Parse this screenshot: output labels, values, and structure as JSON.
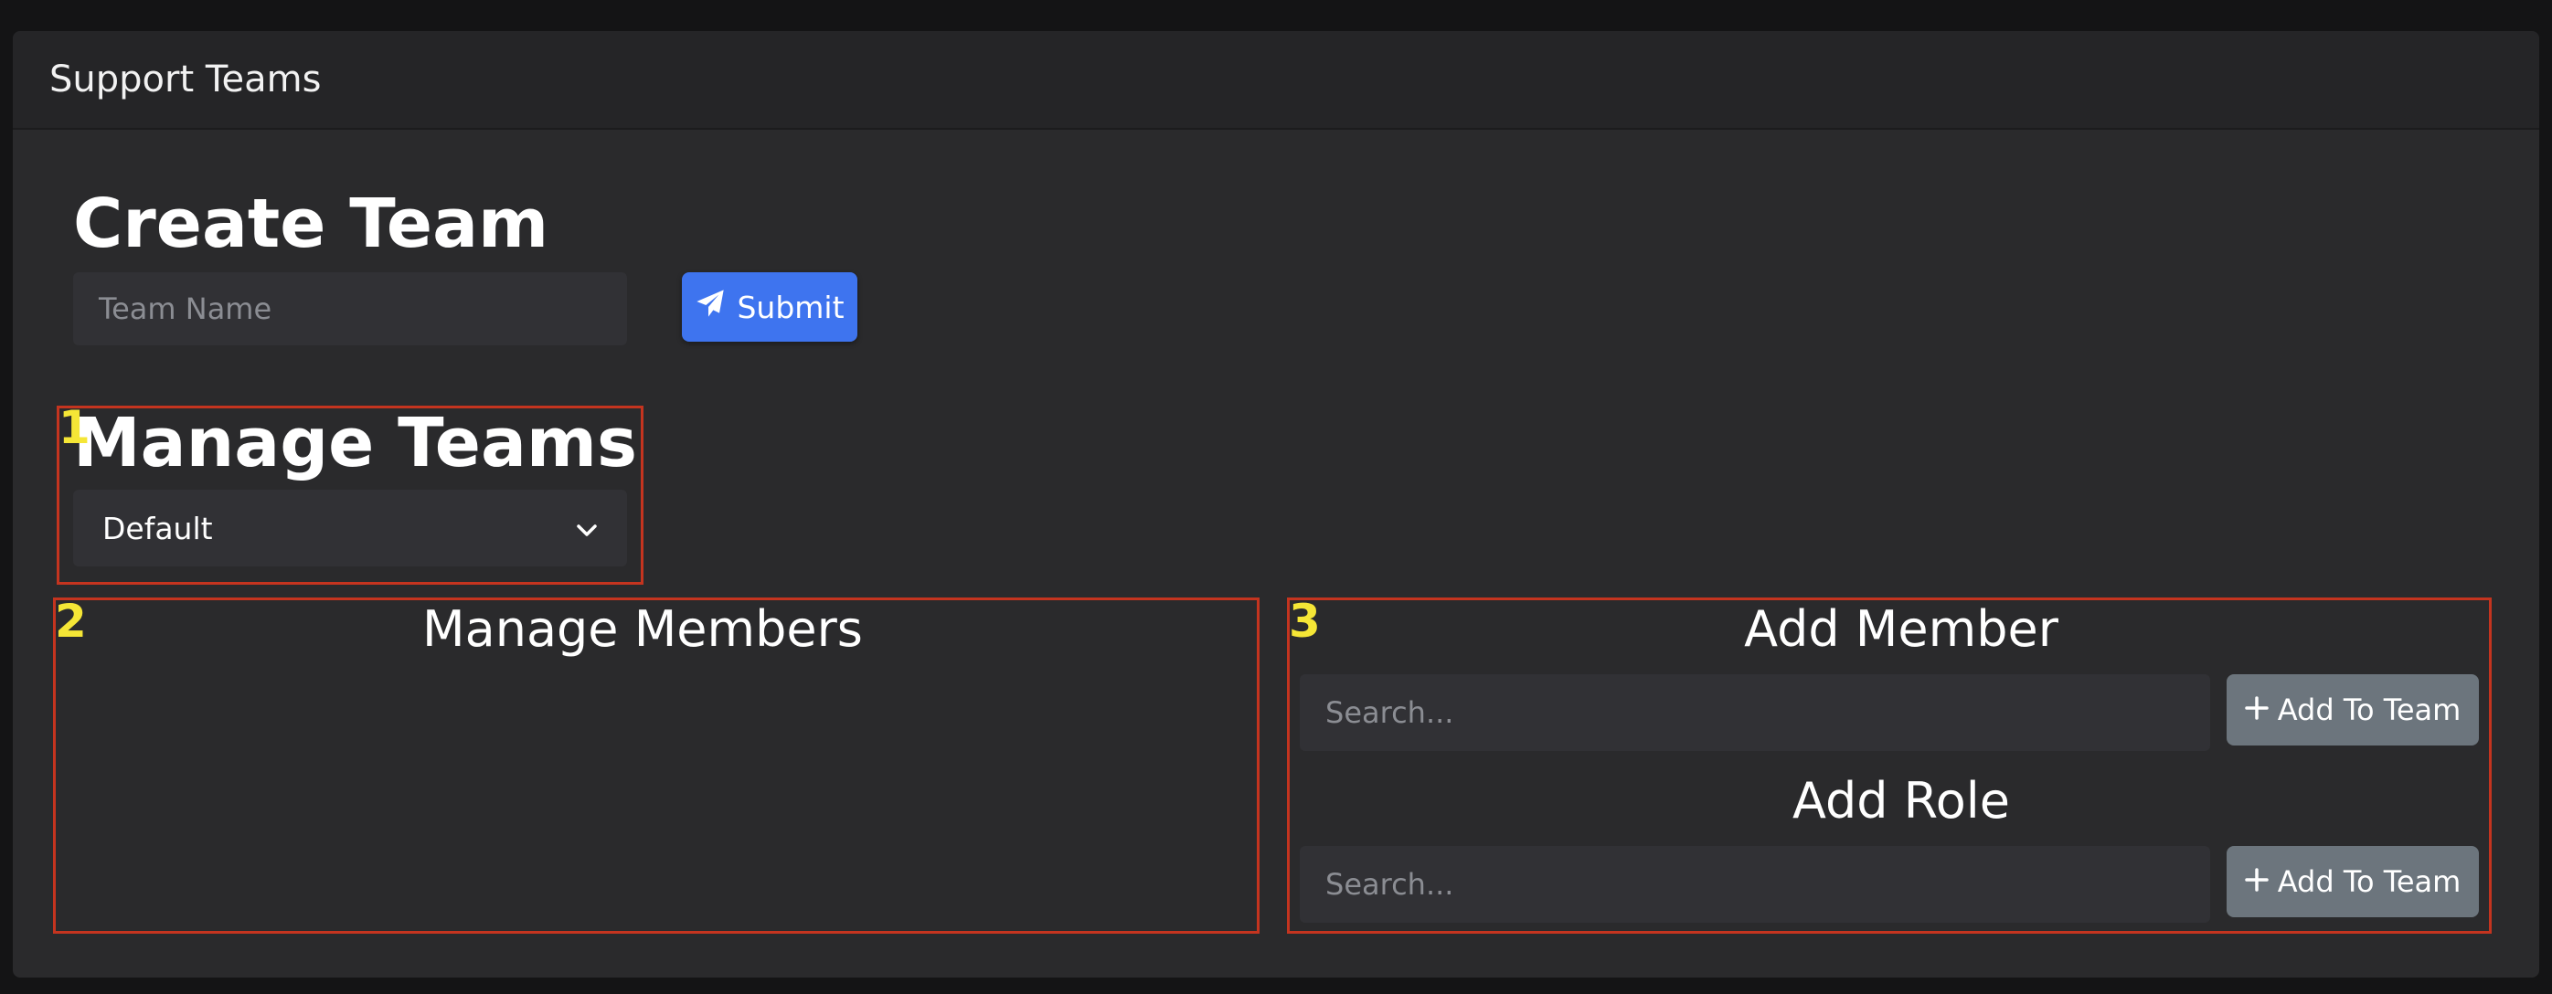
{
  "card": {
    "title": "Support Teams"
  },
  "create_team": {
    "heading": "Create Team",
    "team_name_placeholder": "Team Name",
    "submit_label": "Submit"
  },
  "manage_teams": {
    "heading": "Manage Teams",
    "selected_team": "Default"
  },
  "manage_members": {
    "heading": "Manage Members"
  },
  "add_member": {
    "heading": "Add Member",
    "search_placeholder": "Search...",
    "add_label": "Add To Team"
  },
  "add_role": {
    "heading": "Add Role",
    "search_placeholder": "Search...",
    "add_label": "Add To Team"
  },
  "annotations": {
    "colors": {
      "box": "#c4341f",
      "label": "#f5e636"
    },
    "labels": [
      "1",
      "2",
      "3"
    ]
  },
  "colors": {
    "primary": "#3e74ef",
    "secondary": "#6c757d",
    "background": "#2a2a2c"
  },
  "icons": {
    "submit": "paper-plane-icon",
    "add": "plus-icon",
    "select": "chevron-down-icon"
  }
}
